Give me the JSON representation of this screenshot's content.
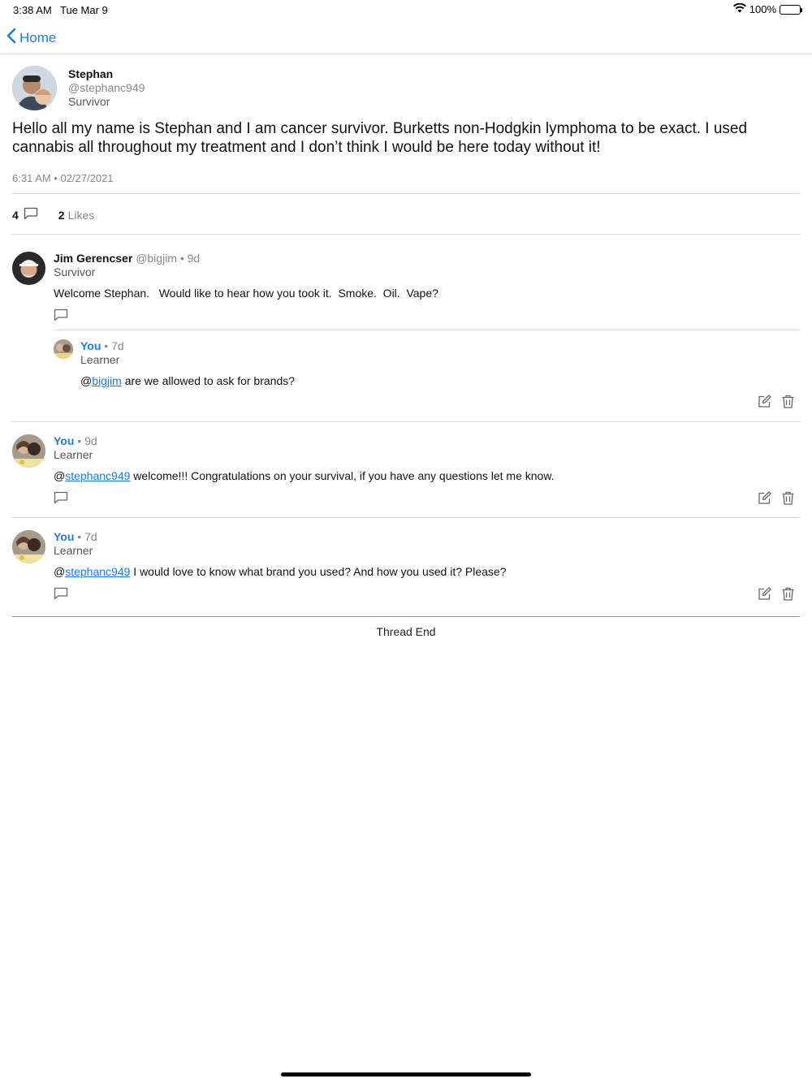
{
  "status_bar": {
    "time": "3:38 AM",
    "date": "Tue Mar 9",
    "battery": "100%",
    "icons": [
      "wifi-icon",
      "battery-icon"
    ]
  },
  "nav": {
    "back_label": "Home",
    "icon": "chevron-left-icon",
    "accent": "#1a7cf0"
  },
  "post": {
    "author": "Stephan",
    "handle": "@stephanc949",
    "role": "Survivor",
    "body": "Hello all my name is Stephan and I am cancer survivor. Burketts non-Hodgkin lymphoma to be exact. I used cannabis all throughout my treatment and I don’t think I would be here today without it!",
    "timestamp": "6:31 AM • 02/27/2021",
    "comment_count": "4",
    "like_count": "2",
    "like_label": "Likes"
  },
  "comments": [
    {
      "author": "Jim Gerencser",
      "handle": "@bigjim",
      "age": "• 9d",
      "role": "Survivor",
      "text": "Welcome Stephan.   Would like to hear how you took it.  Smoke.  Oil.  Vape?",
      "replies": [
        {
          "author": "You",
          "age": "• 7d",
          "role": "Learner",
          "mention": "bigjim",
          "text": "are we allowed to ask for brands?"
        }
      ]
    },
    {
      "author": "You",
      "age": "• 9d",
      "role": "Learner",
      "mention": "stephanc949",
      "text": "welcome!!! Congratulations on your survival, if you have any questions let me know."
    },
    {
      "author": "You",
      "age": "• 7d",
      "role": "Learner",
      "mention": "stephanc949",
      "text": "I would love to know what brand you used? And how you used it? Please?"
    }
  ],
  "at_sign": "@",
  "thread_end": "Thread End",
  "colors": {
    "accent": "#1a7cf0",
    "muted": "#888888",
    "divider": "#dcdcdc",
    "thread_end_line": "#8a9a6a"
  }
}
